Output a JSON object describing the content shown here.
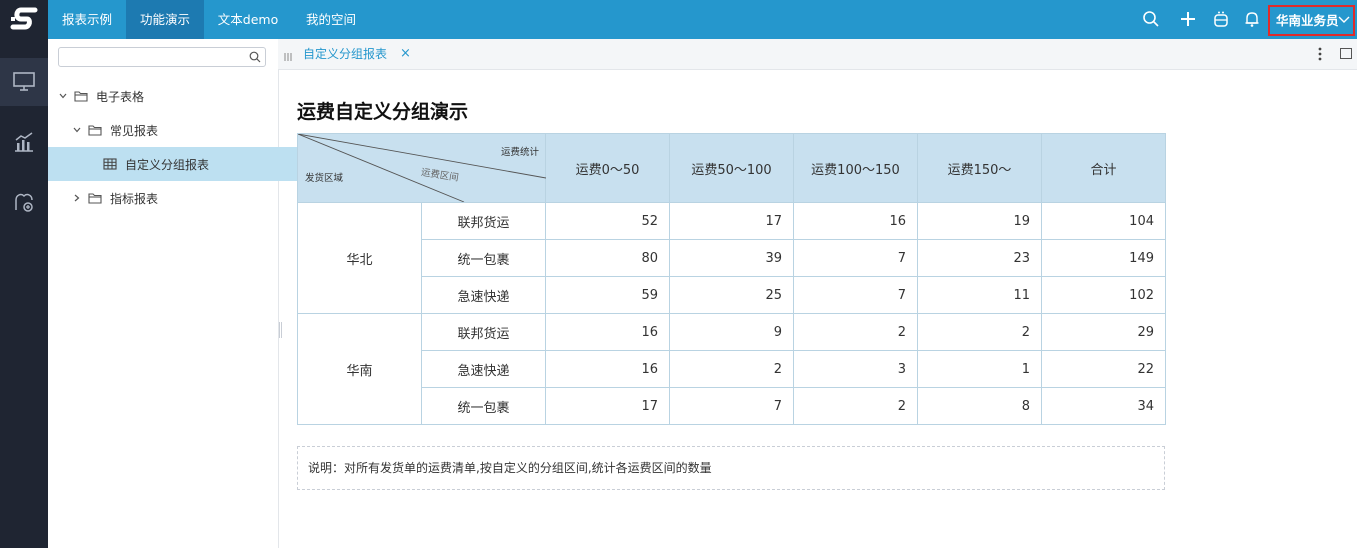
{
  "nav": {
    "items": [
      "报表示例",
      "功能演示",
      "文本demo",
      "我的空间"
    ],
    "active_index": 1,
    "user": "华南业务员"
  },
  "sidebar_icons": [
    "monitor-icon",
    "chart-icon",
    "analysis-icon"
  ],
  "tree": {
    "search_placeholder": "",
    "nodes": [
      {
        "label": "电子表格",
        "type": "folder",
        "expanded": true
      },
      {
        "label": "常见报表",
        "type": "folder",
        "expanded": true
      },
      {
        "label": "自定义分组报表",
        "type": "report",
        "selected": true
      },
      {
        "label": "指标报表",
        "type": "folder",
        "expanded": false
      }
    ]
  },
  "tab": {
    "label": "自定义分组报表",
    "close": "×"
  },
  "report": {
    "title": "运费自定义分组演示",
    "corner": {
      "top_right": "运费统计",
      "middle": "运费区间",
      "bottom_left": "发货区域"
    },
    "columns": [
      "运费0～50",
      "运费50～100",
      "运费100～150",
      "运费150～",
      "合计"
    ],
    "groups": [
      {
        "region": "华北",
        "rows": [
          {
            "carrier": "联邦货运",
            "values": [
              "52",
              "17",
              "16",
              "19",
              "104"
            ]
          },
          {
            "carrier": "统一包裹",
            "values": [
              "80",
              "39",
              "7",
              "23",
              "149"
            ]
          },
          {
            "carrier": "急速快递",
            "values": [
              "59",
              "25",
              "7",
              "11",
              "102"
            ]
          }
        ]
      },
      {
        "region": "华南",
        "rows": [
          {
            "carrier": "联邦货运",
            "values": [
              "16",
              "9",
              "2",
              "2",
              "29"
            ]
          },
          {
            "carrier": "急速快递",
            "values": [
              "16",
              "2",
              "3",
              "1",
              "22"
            ]
          },
          {
            "carrier": "统一包裹",
            "values": [
              "17",
              "7",
              "2",
              "8",
              "34"
            ]
          }
        ]
      }
    ],
    "note": "说明：对所有发货单的运费清单,按自定义的分组区间,统计各运费区间的数量"
  },
  "colors": {
    "topbar": "#2597cd",
    "rail": "#1f2532",
    "header_fill": "#c8e0ef",
    "selection": "#bde0f1",
    "highlight_border": "#e02b2b"
  }
}
